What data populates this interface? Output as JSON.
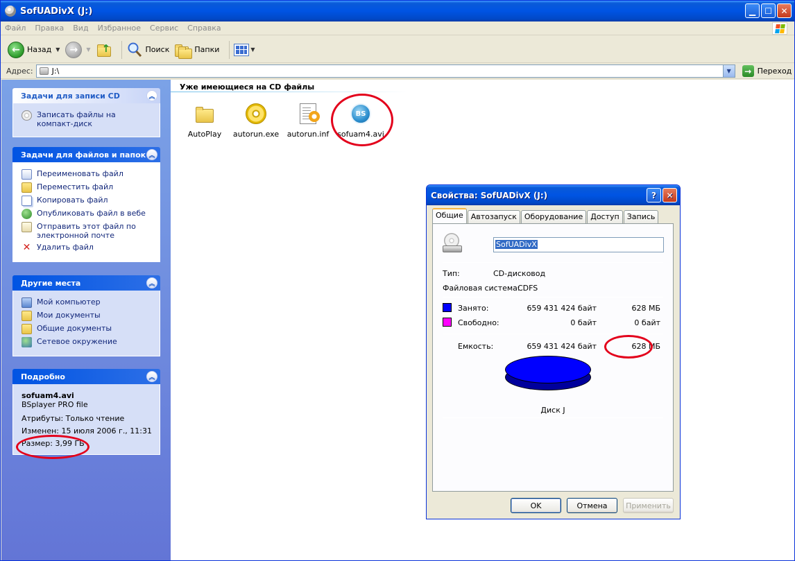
{
  "window": {
    "title": "SofUADivX (J:)"
  },
  "menu": [
    "Файл",
    "Правка",
    "Вид",
    "Избранное",
    "Сервис",
    "Справка"
  ],
  "toolbar": {
    "back_label": "Назад",
    "search_label": "Поиск",
    "folders_label": "Папки"
  },
  "address": {
    "label": "Адрес:",
    "value": "J:\\",
    "go_label": "Переход"
  },
  "taskpane": {
    "cd_tasks": {
      "title": "Задачи для записи CD",
      "items": [
        {
          "label": "Записать файлы на компакт-диск",
          "icon": "burn-cd-icon"
        }
      ]
    },
    "file_tasks": {
      "title": "Задачи для файлов и папок",
      "items": [
        {
          "label": "Переименовать файл",
          "icon": "rename-icon"
        },
        {
          "label": "Переместить файл",
          "icon": "move-icon"
        },
        {
          "label": "Копировать файл",
          "icon": "copy-icon"
        },
        {
          "label": "Опубликовать файл в вебе",
          "icon": "publish-web-icon"
        },
        {
          "label": "Отправить этот файл по электронной почте",
          "icon": "email-icon"
        },
        {
          "label": "Удалить файл",
          "icon": "delete-icon"
        }
      ]
    },
    "other_places": {
      "title": "Другие места",
      "items": [
        {
          "label": "Мой компьютер",
          "icon": "my-computer-icon"
        },
        {
          "label": "Мои документы",
          "icon": "my-documents-icon"
        },
        {
          "label": "Общие документы",
          "icon": "shared-documents-icon"
        },
        {
          "label": "Сетевое окружение",
          "icon": "network-icon"
        }
      ]
    },
    "details": {
      "title": "Подробно",
      "name": "sofuam4.avi",
      "type": "BSplayer PRO file",
      "attributes": "Атрибуты: Только чтение",
      "modified": "Изменен: 15 июля 2006 г., 11:31",
      "size": "Размер: 3,99 ГБ"
    }
  },
  "content": {
    "section_title": "Уже имеющиеся на CD файлы",
    "files": [
      {
        "name": "AutoPlay",
        "icon": "folder-icon"
      },
      {
        "name": "autorun.exe",
        "icon": "cd-exe-icon"
      },
      {
        "name": "autorun.inf",
        "icon": "inf-file-icon"
      },
      {
        "name": "sofuam4.avi",
        "icon": "bsplayer-icon",
        "icon_text": "BS"
      }
    ]
  },
  "dialog": {
    "title": "Свойства: SofUADivX (J:)",
    "tabs": [
      "Общие",
      "Автозапуск",
      "Оборудование",
      "Доступ",
      "Запись"
    ],
    "label_name": "SofUADivX",
    "type_label": "Тип:",
    "type_value": "CD-дисковод",
    "fs_label": "Файловая система:",
    "fs_value": "CDFS",
    "used_label": "Занято:",
    "used_bytes": "659 431 424 байт",
    "used_mb": "628 МБ",
    "free_label": "Свободно:",
    "free_bytes": "0 байт",
    "free_mb": "0 байт",
    "capacity_label": "Емкость:",
    "capacity_bytes": "659 431 424 байт",
    "capacity_mb": "628 МБ",
    "disk_label": "Диск J",
    "used_color": "#0000ff",
    "free_color": "#ff00ff",
    "ok_label": "OK",
    "cancel_label": "Отмена",
    "apply_label": "Применить"
  }
}
